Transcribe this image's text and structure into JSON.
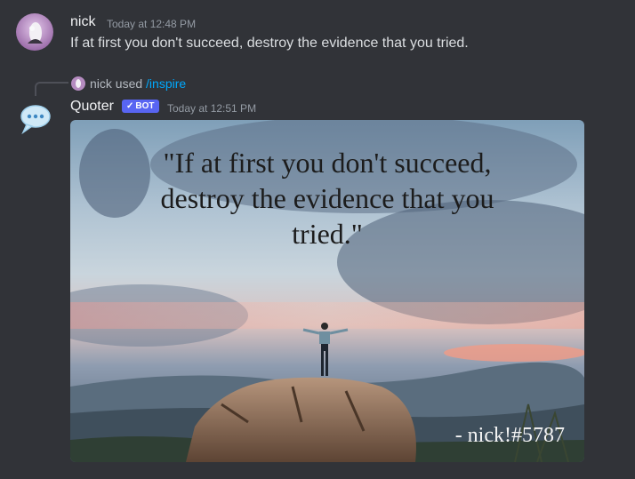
{
  "message1": {
    "username": "nick",
    "timestamp": "Today at 12:48 PM",
    "content": "If at first you don't succeed, destroy the evidence that you tried."
  },
  "message2": {
    "reply_user": "nick",
    "reply_used": "used",
    "reply_command": "/inspire",
    "username": "Quoter",
    "bot_tag": "BOT",
    "bot_check": "✓",
    "timestamp": "Today at 12:51 PM",
    "avatar_icon": "speech-bubble-icon",
    "image": {
      "quote_line1": "\"If at first you don't succeed,",
      "quote_line2": "destroy the evidence that you",
      "quote_line3": "tried.\"",
      "signature": "- nick!#5787"
    }
  },
  "colors": {
    "background": "#313338",
    "bot_tag": "#5865f2",
    "command_link": "#00a8fc"
  }
}
